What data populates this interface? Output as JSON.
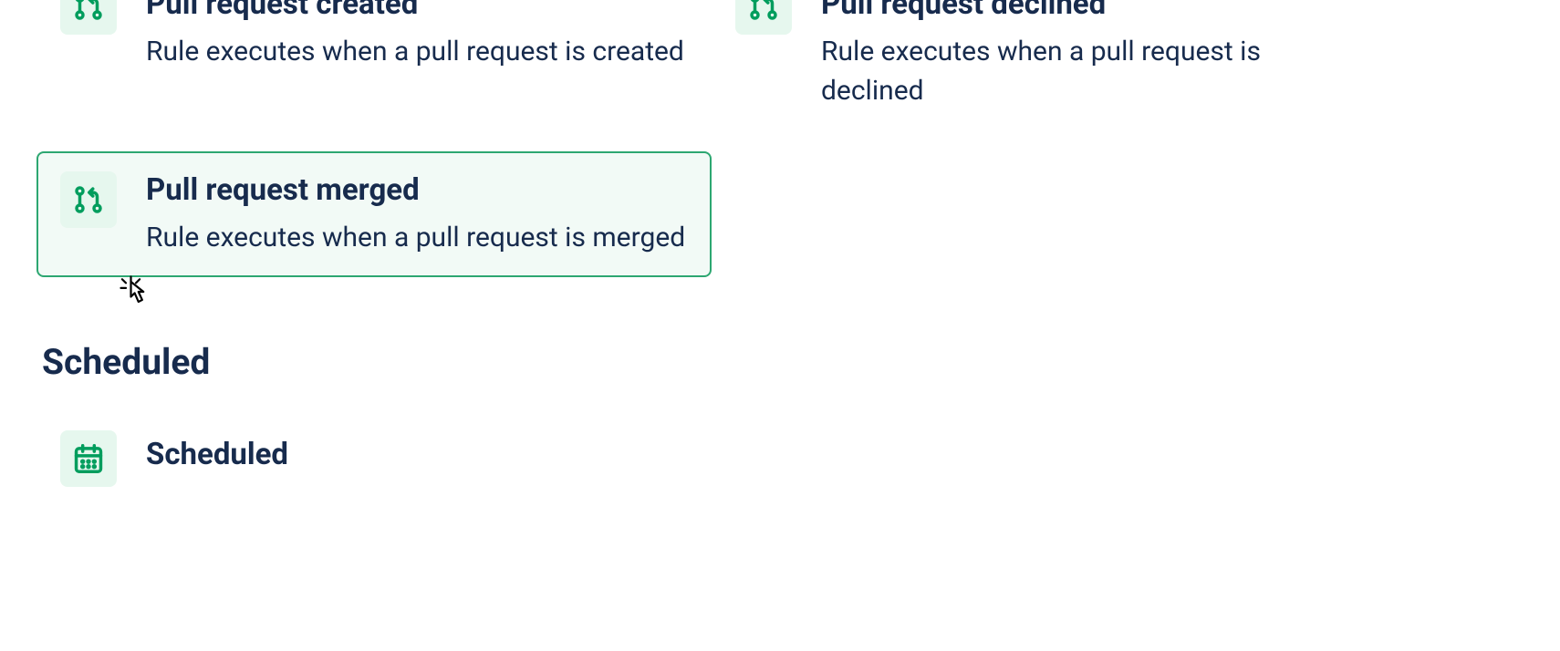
{
  "triggers": {
    "pr_created": {
      "title": "Pull request created",
      "desc": "Rule executes when a pull request is created"
    },
    "pr_declined": {
      "title": "Pull request declined",
      "desc": "Rule executes when a pull request is declined"
    },
    "pr_merged": {
      "title": "Pull request merged",
      "desc": "Rule executes when a pull request is merged"
    },
    "scheduled": {
      "title": "Scheduled"
    }
  },
  "sections": {
    "scheduled": "Scheduled"
  },
  "colors": {
    "icon_bg": "#e6f7ee",
    "icon_fg": "#009d5d",
    "selected_border": "#2da771",
    "selected_bg": "#f2faf6",
    "text": "#172b4d"
  }
}
